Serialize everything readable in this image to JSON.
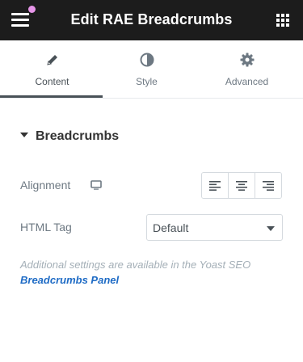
{
  "header": {
    "title": "Edit RAE Breadcrumbs",
    "menu_icon": "hamburger-icon",
    "apps_icon": "grid-icon",
    "notification_color": "#e695e8",
    "background": "#1c1c1c"
  },
  "tabs": [
    {
      "label": "Content",
      "icon": "pencil-icon",
      "active": true
    },
    {
      "label": "Style",
      "icon": "half-circle-icon",
      "active": false
    },
    {
      "label": "Advanced",
      "icon": "gear-icon",
      "active": false
    }
  ],
  "section": {
    "title": "Breadcrumbs",
    "expanded": true
  },
  "controls": {
    "alignment": {
      "label": "Alignment",
      "responsive_icon": "desktop-icon",
      "options": [
        "left",
        "center",
        "right"
      ]
    },
    "html_tag": {
      "label": "HTML Tag",
      "value": "Default"
    }
  },
  "note": {
    "text": "Additional settings are available in the Yoast SEO",
    "link_text": "Breadcrumbs Panel",
    "link_color": "#1e6bc5"
  }
}
